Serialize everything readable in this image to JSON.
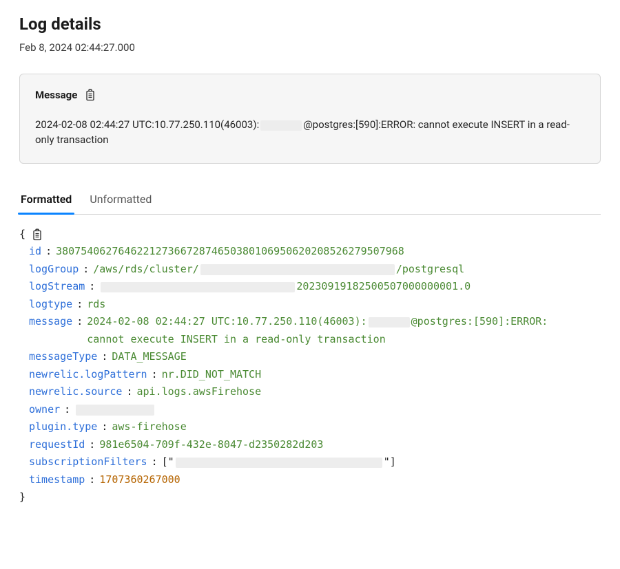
{
  "header": {
    "title": "Log details",
    "subtitle": "Feb 8, 2024 02:44:27.000"
  },
  "message_panel": {
    "title": "Message",
    "body_parts": {
      "prefix": "2024-02-08 02:44:27 UTC:10.77.250.110(46003):",
      "suffix": "@postgres:[590]:ERROR:  cannot execute INSERT in a read-only transaction"
    }
  },
  "tabs": {
    "formatted": "Formatted",
    "unformatted": "Unformatted"
  },
  "json_view": {
    "open_brace": "{",
    "close_brace": "}",
    "rows": {
      "id": {
        "key": "id",
        "value": "38075406276462212736672874650380106950620208526279507968",
        "type": "str"
      },
      "logGroup": {
        "key": "logGroup",
        "prefix": "/aws/rds/cluster/",
        "suffix": "/postgresql"
      },
      "logStream": {
        "key": "logStream",
        "suffix": "2023091918250050700000000​1.0"
      },
      "logtype": {
        "key": "logtype",
        "value": "rds",
        "type": "str"
      },
      "message": {
        "key": "message",
        "prefix": "2024-02-08 02:44:27 UTC:10.77.250.110(46003):",
        "suffix": "@postgres:[590]:ERROR:  cannot execute INSERT in a read-only transaction"
      },
      "messageType": {
        "key": "messageType",
        "value": "DATA_MESSAGE",
        "type": "str"
      },
      "logPattern": {
        "key": "newrelic.logPattern",
        "value": "nr.DID_NOT_MATCH",
        "type": "str"
      },
      "source": {
        "key": "newrelic.source",
        "value": "api.logs.awsFirehose",
        "type": "str"
      },
      "owner": {
        "key": "owner"
      },
      "pluginType": {
        "key": "plugin.type",
        "value": "aws-firehose",
        "type": "str"
      },
      "requestId": {
        "key": "requestId",
        "value": "981e6504-709f-432e-8047-d2350282d203",
        "type": "str"
      },
      "subscriptionFilters": {
        "key": "subscriptionFilters",
        "open": "[\"",
        "close": "\"]"
      },
      "timestamp": {
        "key": "timestamp",
        "value": "1707360267000",
        "type": "num"
      }
    }
  }
}
